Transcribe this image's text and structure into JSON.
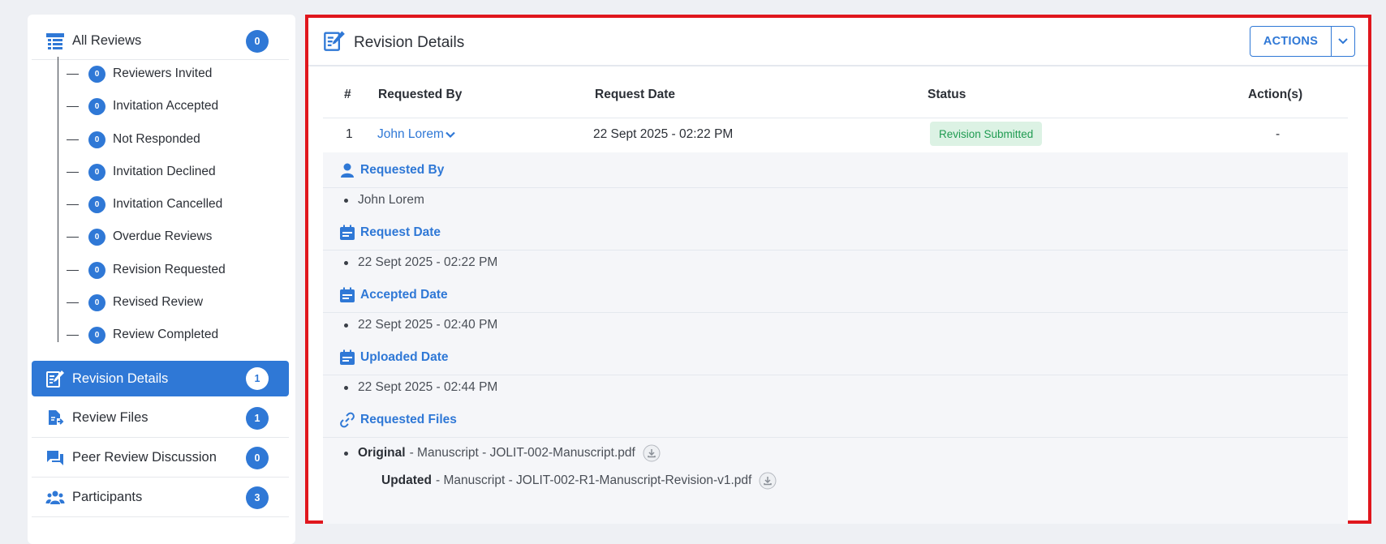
{
  "sidebar": {
    "all_reviews": {
      "label": "All Reviews",
      "count": "0"
    },
    "sub_items": [
      {
        "label": "Reviewers Invited",
        "count": "0"
      },
      {
        "label": "Invitation Accepted",
        "count": "0"
      },
      {
        "label": "Not Responded",
        "count": "0"
      },
      {
        "label": "Invitation Declined",
        "count": "0"
      },
      {
        "label": "Invitation Cancelled",
        "count": "0"
      },
      {
        "label": "Overdue Reviews",
        "count": "0"
      },
      {
        "label": "Revision Requested",
        "count": "0"
      },
      {
        "label": "Revised Review",
        "count": "0"
      },
      {
        "label": "Review Completed",
        "count": "0"
      }
    ],
    "items": [
      {
        "label": "Revision Details",
        "count": "1",
        "icon": "edit-document-icon",
        "active": true
      },
      {
        "label": "Review Files",
        "count": "1",
        "icon": "file-upload-icon"
      },
      {
        "label": "Peer Review Discussion",
        "count": "0",
        "icon": "chat-icon"
      },
      {
        "label": "Participants",
        "count": "3",
        "icon": "people-icon"
      }
    ]
  },
  "panel": {
    "title": "Revision Details",
    "actions_label": "ACTIONS"
  },
  "table": {
    "headers": [
      "#",
      "Requested By",
      "Request Date",
      "Status",
      "Action(s)"
    ],
    "rows": [
      {
        "index": "1",
        "requested_by": "John Lorem",
        "request_date": "22 Sept 2025 - 02:22 PM",
        "status": "Revision Submitted",
        "actions": "-"
      }
    ]
  },
  "details": {
    "requested_by": {
      "title": "Requested By",
      "value": "John Lorem"
    },
    "request_date": {
      "title": "Request Date",
      "value": "22 Sept 2025 - 02:22 PM"
    },
    "accepted_date": {
      "title": "Accepted Date",
      "value": "22 Sept 2025 - 02:40 PM"
    },
    "uploaded_date": {
      "title": "Uploaded Date",
      "value": "22 Sept 2025 - 02:44 PM"
    },
    "requested_files": {
      "title": "Requested Files",
      "original_label": "Original",
      "original_file": "- Manuscript - JOLIT-002-Manuscript.pdf",
      "updated_label": "Updated",
      "updated_file": "- Manuscript - JOLIT-002-R1-Manuscript-Revision-v1.pdf"
    }
  },
  "colors": {
    "accent": "#2f78d6",
    "highlight_border": "#e0161d",
    "status_bg": "#dcf2e4",
    "status_text": "#1f9b51"
  }
}
